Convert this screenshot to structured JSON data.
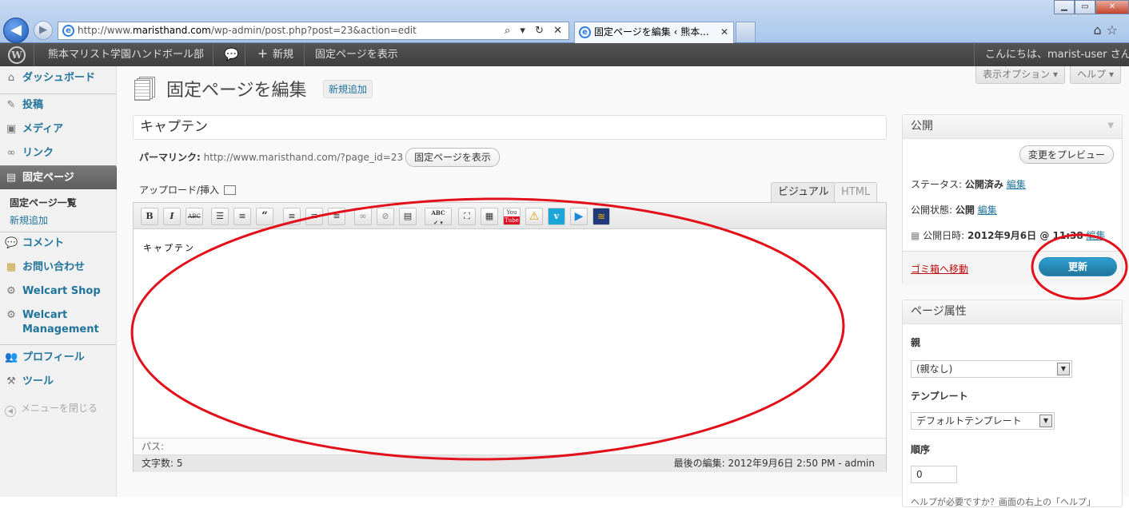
{
  "browser": {
    "url_prefix": "http://www.",
    "url_domain": "maristhand.com",
    "url_path": "/wp-admin/post.php?post=23&action=edit",
    "tab_title": "固定ページを編集 ‹ 熊本...",
    "address_tools": "⌕ ▾ ↻ ✕",
    "tab_close": "✕"
  },
  "adminbar": {
    "site_name": "熊本マリスト学園ハンドボール部",
    "new_label": "新規",
    "view_page": "固定ページを表示",
    "greeting": "こんにちは、marist-user さん！"
  },
  "sidebar": {
    "dashboard": "ダッシュボード",
    "posts": "投稿",
    "media": "メディア",
    "links": "リンク",
    "pages": "固定ページ",
    "pages_all": "固定ページ一覧",
    "pages_new": "新規追加",
    "comments": "コメント",
    "contact": "お問い合わせ",
    "welcart_shop": "Welcart Shop",
    "welcart_mgmt_1": "Welcart",
    "welcart_mgmt_2": "Management",
    "profile": "プロフィール",
    "tools": "ツール",
    "collapse": "メニューを閉じる"
  },
  "header": {
    "screen_options": "表示オプション ▾",
    "help": "ヘルプ ▾",
    "title": "固定ページを編集",
    "add_new": "新規追加"
  },
  "post": {
    "title": "キャプテン",
    "permalink_label": "パーマリンク:",
    "permalink_url": "http://www.maristhand.com/?page_id=23",
    "view_page_button": "固定ページを表示",
    "upload_insert": "アップロード/挿入",
    "tab_visual": "ビジュアル",
    "tab_html": "HTML",
    "content": "キャプテン",
    "path_label": "パス:",
    "word_count": "文字数: 5",
    "last_edited": "最後の編集: 2012年9月6日 2:50 PM - admin"
  },
  "toolbar": {
    "bold": "B",
    "italic": "I",
    "strike": "ABC",
    "quote": "66",
    "spell": "ABC"
  },
  "publish": {
    "heading": "公開",
    "preview": "変更をプレビュー",
    "status_label": "ステータス:",
    "status_value": "公開済み",
    "visibility_label": "公開状態:",
    "visibility_value": "公開",
    "edit": "編集",
    "date_label": "公開日時:",
    "date_value": "2012年9月6日 @ 11:38",
    "trash": "ゴミ箱へ移動",
    "update": "更新"
  },
  "attributes": {
    "heading": "ページ属性",
    "parent_label": "親",
    "parent_value": "(親なし)",
    "template_label": "テンプレート",
    "template_value": "デフォルトテンプレート",
    "order_label": "順序",
    "order_value": "0",
    "help_note": "ヘルプが必要ですか？画面の右上の「ヘルプ」"
  },
  "colors": {
    "link": "#21759b",
    "annotation": "#e1101a",
    "update_button": "#21759b"
  }
}
